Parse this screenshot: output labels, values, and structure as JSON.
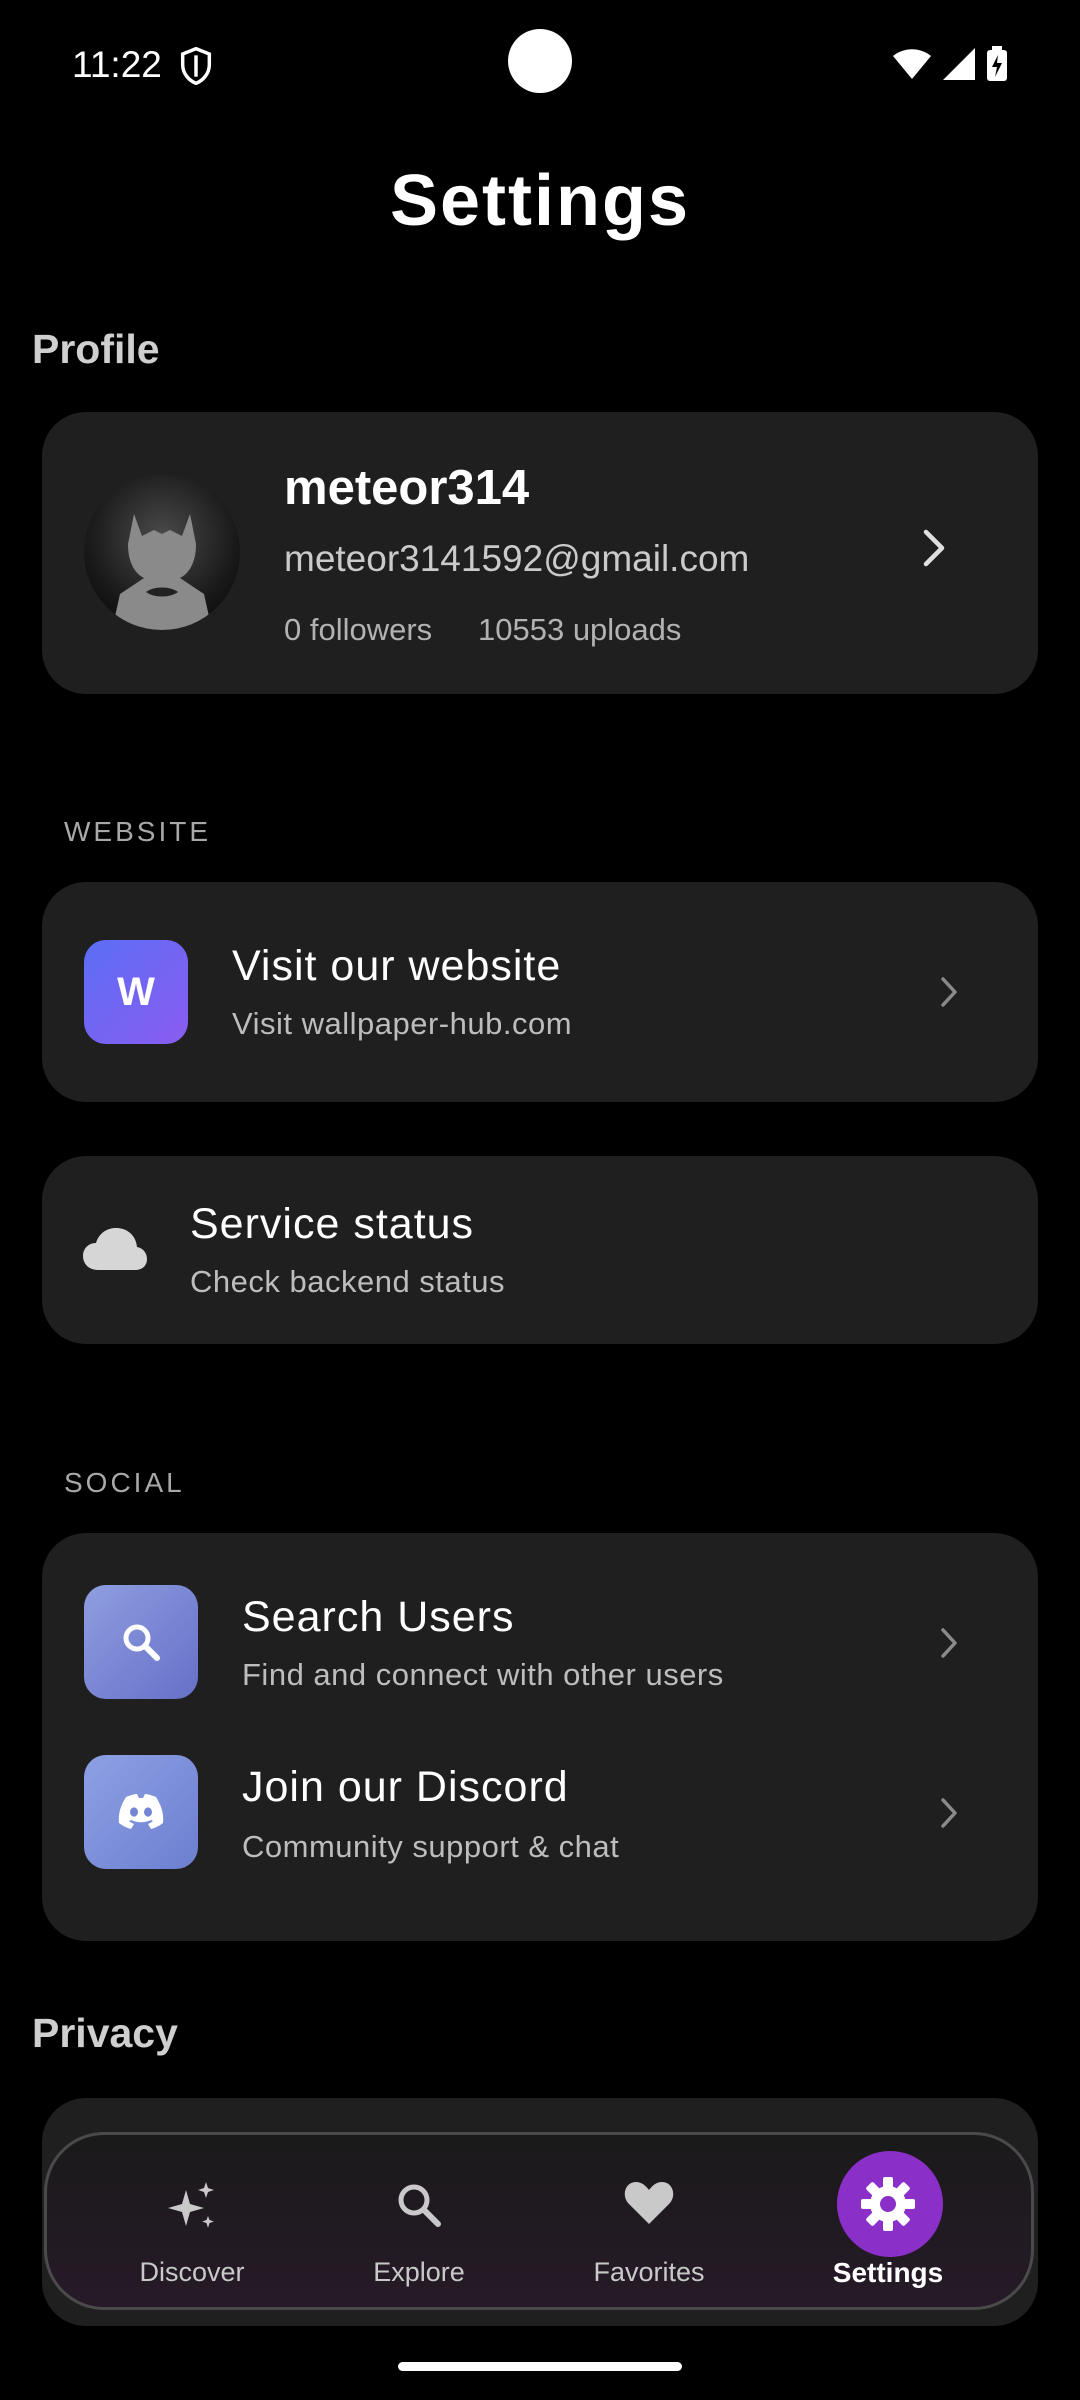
{
  "status_bar": {
    "time": "11:22"
  },
  "page": {
    "title": "Settings"
  },
  "profile_section": {
    "heading": "Profile",
    "name": "meteor314",
    "email": "meteor3141592@gmail.com",
    "followers": "0 followers",
    "uploads": "10553 uploads"
  },
  "website_section": {
    "caption": "WEBSITE",
    "visit": {
      "tile_letter": "W",
      "title": "Visit our website",
      "subtitle": "Visit wallpaper-hub.com"
    },
    "status": {
      "title": "Service status",
      "subtitle": "Check backend status"
    }
  },
  "social_section": {
    "caption": "SOCIAL",
    "search": {
      "title": "Search Users",
      "subtitle": "Find and connect with other users"
    },
    "discord": {
      "title": "Join our Discord",
      "subtitle": "Community support & chat"
    }
  },
  "privacy_section": {
    "heading": "Privacy"
  },
  "bottom_nav": {
    "items": [
      {
        "label": "Discover",
        "icon": "sparkles-icon"
      },
      {
        "label": "Explore",
        "icon": "search-icon"
      },
      {
        "label": "Favorites",
        "icon": "heart-icon"
      },
      {
        "label": "Settings",
        "icon": "gear-icon",
        "active": true
      }
    ]
  },
  "colors": {
    "background": "#000000",
    "card": "#1f1f1f",
    "accent": "#8b2fc9",
    "website_tile": "#6a66f3",
    "social_tile": "#7a86d6"
  }
}
